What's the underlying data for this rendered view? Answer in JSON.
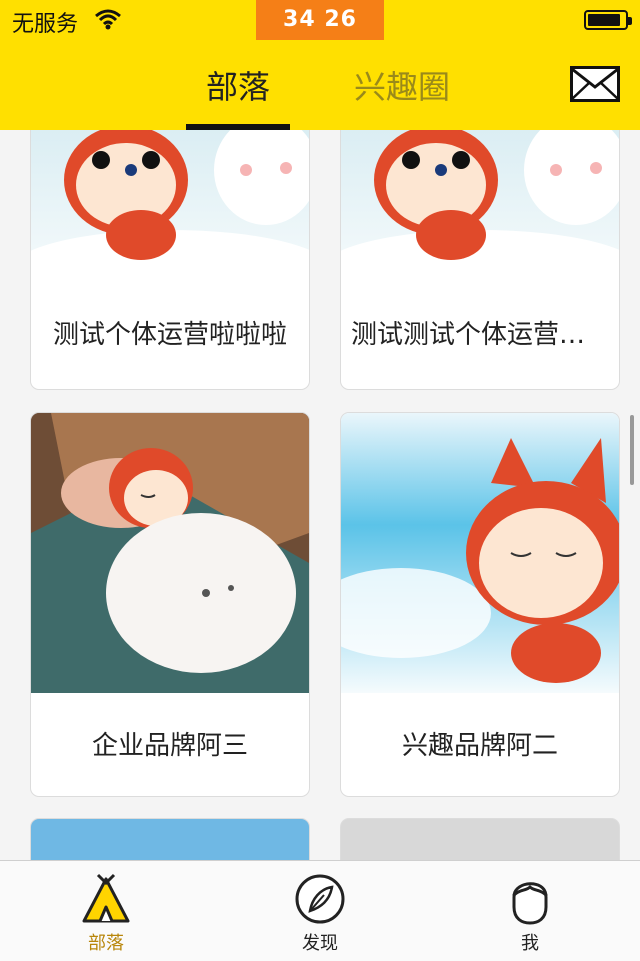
{
  "status_bar": {
    "carrier": "无服务",
    "time": "34 26",
    "wifi_icon": "wifi-icon",
    "battery_icon": "battery-icon"
  },
  "header": {
    "tabs": [
      {
        "label": "部落",
        "active": true
      },
      {
        "label": "兴趣圈",
        "active": false
      }
    ],
    "mail_icon": "envelope-icon"
  },
  "cards": [
    {
      "title": "测试个体运营啦啦啦"
    },
    {
      "title": "测试测试个体运营啦啦啦"
    },
    {
      "title": "企业品牌阿三"
    },
    {
      "title": "兴趣品牌阿二"
    }
  ],
  "tab_bar": {
    "items": [
      {
        "label": "部落",
        "icon": "tent-icon",
        "active": true
      },
      {
        "label": "发现",
        "icon": "compass-icon",
        "active": false
      },
      {
        "label": "我",
        "icon": "user-face-icon",
        "active": false
      }
    ],
    "active_color": "#b8860b"
  },
  "colors": {
    "header_bg": "#ffe000",
    "clock_bg": "#f57f17",
    "inactive_tab": "#9a8a1a"
  }
}
